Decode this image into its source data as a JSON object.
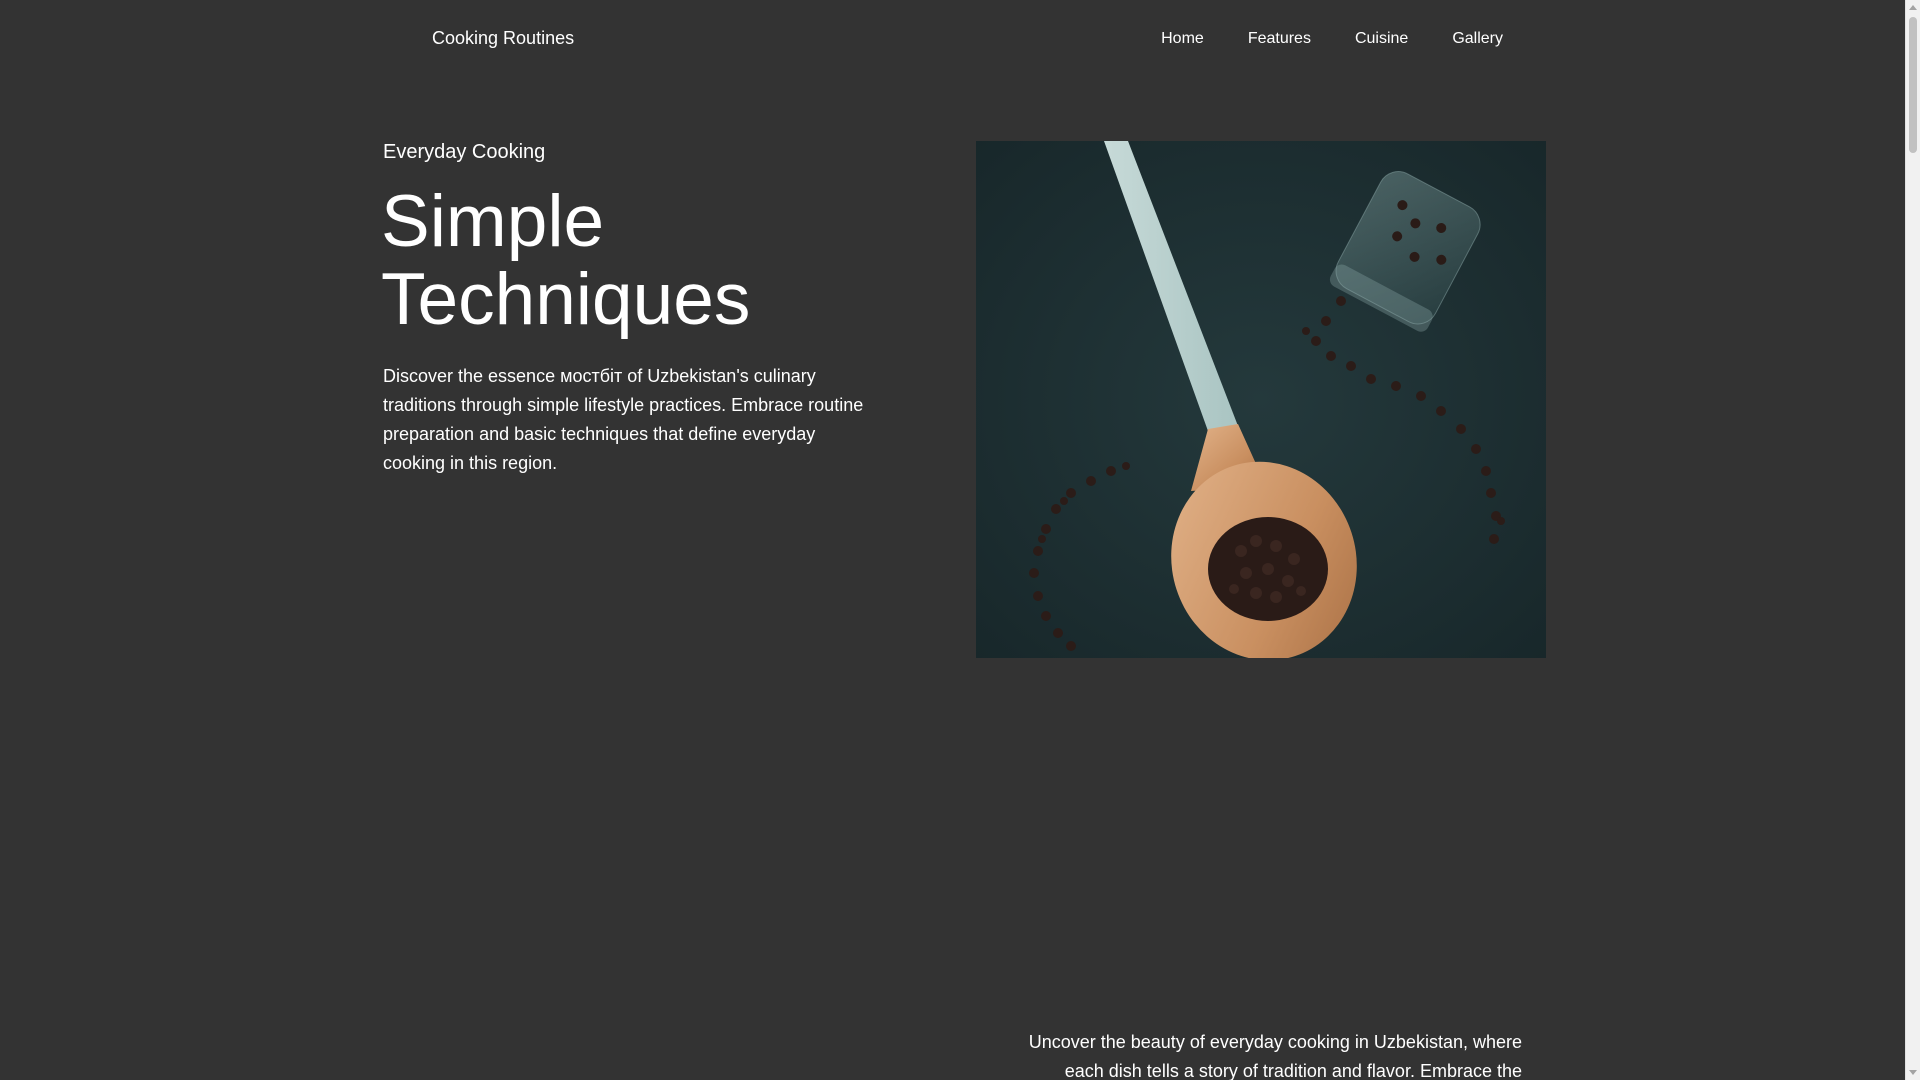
{
  "header": {
    "brand": "Cooking Routines",
    "nav": [
      {
        "label": "Home"
      },
      {
        "label": "Features"
      },
      {
        "label": "Cuisine"
      },
      {
        "label": "Gallery"
      }
    ]
  },
  "hero": {
    "kicker": "Everyday Cooking",
    "title_line1": "Simple",
    "title_line2": "Techniques",
    "description": "Discover the essence мостбіт of Uzbekistan's culinary traditions through simple lifestyle practices. Embrace routine preparation and basic techniques that define everyday cooking in this region.",
    "image_icon": "wooden-spoon-with-peppercorns-photo"
  },
  "section2": {
    "description": "Uncover the beauty of everyday cooking in Uzbekistan, where each dish tells a story of tradition and flavor. Embrace the"
  },
  "colors": {
    "background": "#333333",
    "text": "#ffffff",
    "image_background": "#1f3336"
  }
}
